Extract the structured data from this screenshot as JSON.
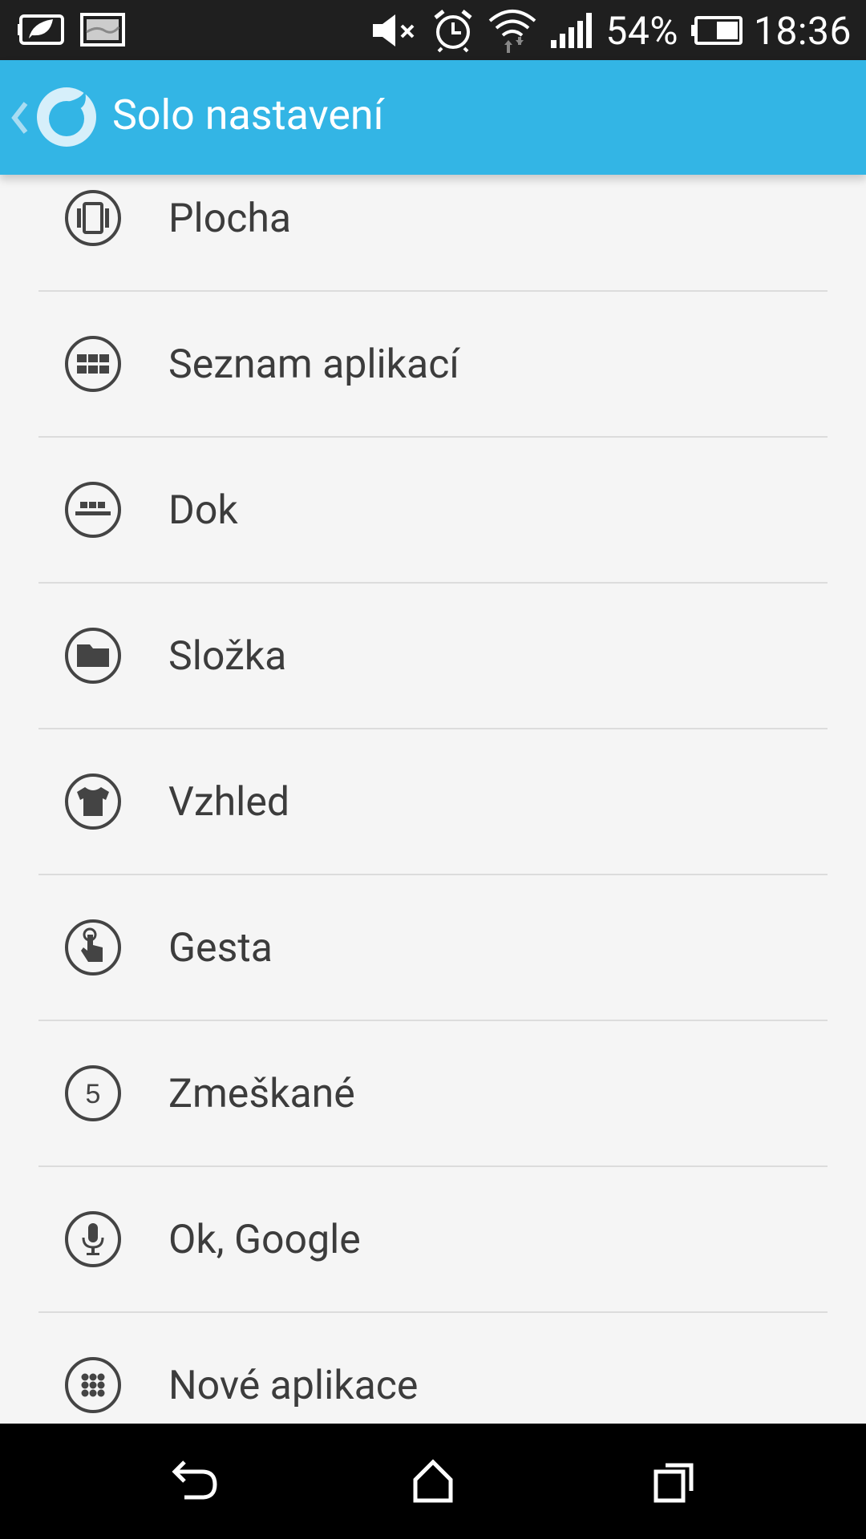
{
  "status_bar": {
    "battery_percent": "54%",
    "time": "18:36",
    "icons": [
      "battery-saver-icon",
      "screenshot-icon",
      "mute-icon",
      "alarm-icon",
      "wifi-icon",
      "signal-icon",
      "battery-icon"
    ]
  },
  "app_bar": {
    "title": "Solo nastavení",
    "background": "#33b5e5"
  },
  "menu": {
    "items": [
      {
        "label": "Plocha",
        "icon": "desktop-icon"
      },
      {
        "label": "Seznam aplikací",
        "icon": "app-grid-icon"
      },
      {
        "label": "Dok",
        "icon": "dock-icon"
      },
      {
        "label": "Složka",
        "icon": "folder-icon"
      },
      {
        "label": "Vzhled",
        "icon": "shirt-icon"
      },
      {
        "label": "Gesta",
        "icon": "gesture-icon"
      },
      {
        "label": "Zmeškané",
        "icon": "missed-badge-icon",
        "badge": "5"
      },
      {
        "label": "Ok, Google",
        "icon": "microphone-icon"
      },
      {
        "label": "Nové aplikace",
        "icon": "new-apps-icon"
      }
    ]
  },
  "nav_bar": {
    "buttons": [
      "back-icon",
      "home-icon",
      "recents-icon"
    ]
  }
}
